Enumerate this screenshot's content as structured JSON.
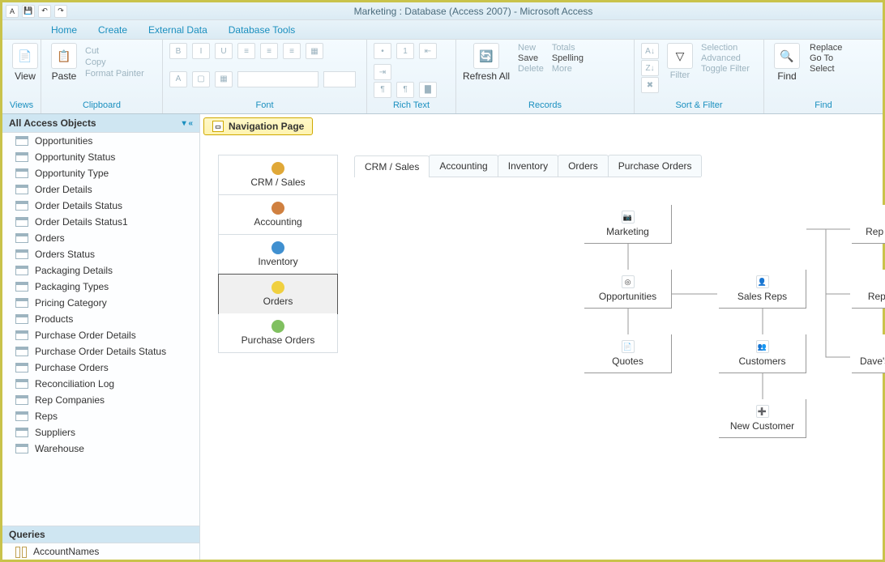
{
  "title": "Marketing : Database (Access 2007) - Microsoft Access",
  "ribbonTabs": [
    "Home",
    "Create",
    "External Data",
    "Database Tools"
  ],
  "ribbon": {
    "views": {
      "name": "Views",
      "view": "View"
    },
    "clipboard": {
      "name": "Clipboard",
      "paste": "Paste",
      "cut": "Cut",
      "copy": "Copy",
      "fp": "Format Painter"
    },
    "font": {
      "name": "Font"
    },
    "richtext": {
      "name": "Rich Text"
    },
    "records": {
      "name": "Records",
      "refresh": "Refresh All",
      "new": "New",
      "save": "Save",
      "delete": "Delete",
      "totals": "Totals",
      "spelling": "Spelling",
      "more": "More"
    },
    "sortfilter": {
      "name": "Sort & Filter",
      "filter": "Filter",
      "selection": "Selection",
      "advanced": "Advanced",
      "toggle": "Toggle Filter"
    },
    "find": {
      "name": "Find",
      "find": "Find",
      "replace": "Replace",
      "goto": "Go To",
      "select": "Select"
    }
  },
  "navHeader": "All Access Objects",
  "navItems": [
    "Opportunities",
    "Opportunity Status",
    "Opportunity Type",
    "Order Details",
    "Order Details Status",
    "Order Details Status1",
    "Orders",
    "Orders Status",
    "Packaging Details",
    "Packaging Types",
    "Pricing Category",
    "Products",
    "Purchase Order Details",
    "Purchase Order Details Status",
    "Purchase Orders",
    "Reconciliation Log",
    "Rep Companies",
    "Reps",
    "Suppliers",
    "Warehouse"
  ],
  "navQueriesHeader": "Queries",
  "navQueries": [
    "AccountNames"
  ],
  "docTab": "Navigation Page",
  "vtabs": [
    "CRM / Sales",
    "Accounting",
    "Inventory",
    "Orders",
    "Purchase Orders"
  ],
  "htabs": [
    "CRM / Sales",
    "Accounting",
    "Inventory",
    "Orders",
    "Purchase Orders"
  ],
  "diagram": {
    "marketing": "Marketing",
    "opportunities": "Opportunities",
    "quotes": "Quotes",
    "salesreps": "Sales Reps",
    "customers": "Customers",
    "newcustomer": "New Customer",
    "repearnings": "Rep Earnings",
    "repreports": "Rep Reports",
    "davesearnings": "Dave's Earnings"
  }
}
